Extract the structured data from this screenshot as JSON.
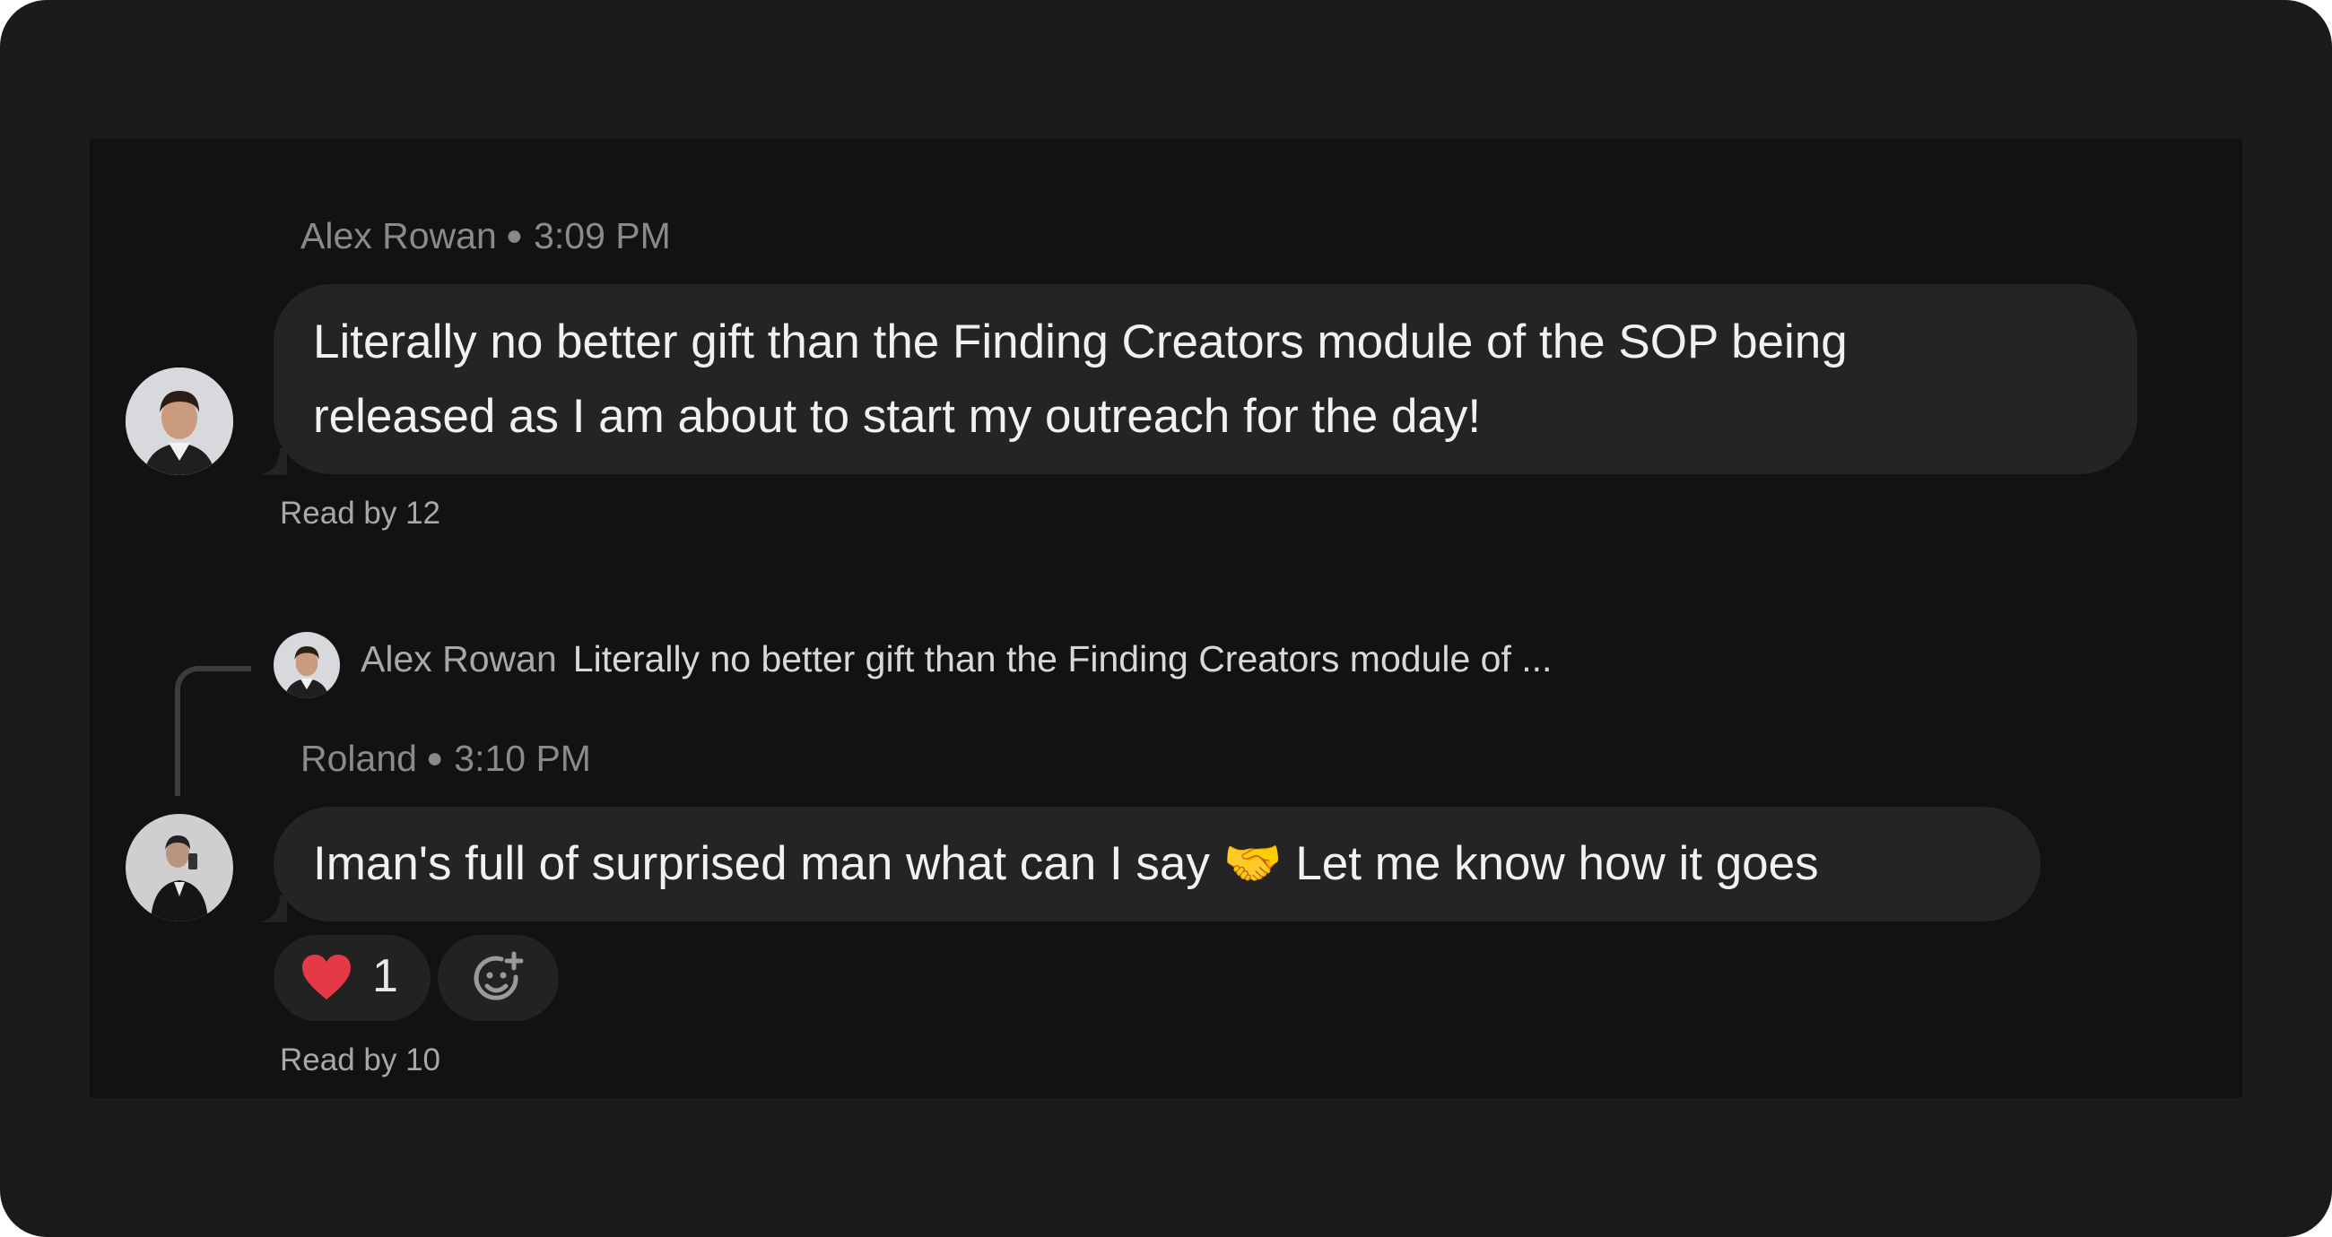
{
  "messages": [
    {
      "author": "Alex Rowan",
      "time": "3:09 PM",
      "text_lines": [
        "Literally no better gift than the Finding Creators module of the SOP being",
        "released as I am about to start my outreach for the day!"
      ],
      "read_by": "Read by 12"
    },
    {
      "reply_to": {
        "author": "Alex Rowan",
        "excerpt": "Literally no better gift than the Finding Creators module of ..."
      },
      "author": "Roland",
      "time": "3:10 PM",
      "text": "Iman's full of surprised man what can I say 🤝 Let me know how it goes",
      "reactions": [
        {
          "emoji_icon": "heart-icon",
          "count": "1"
        }
      ],
      "read_by": "Read by 10"
    }
  ],
  "icons": {
    "add_reaction": "add-emoji-icon"
  },
  "colors": {
    "background_outer": "#1b1b1b",
    "background_panel": "#121212",
    "bubble": "#242424",
    "heart": "#e53a45"
  }
}
